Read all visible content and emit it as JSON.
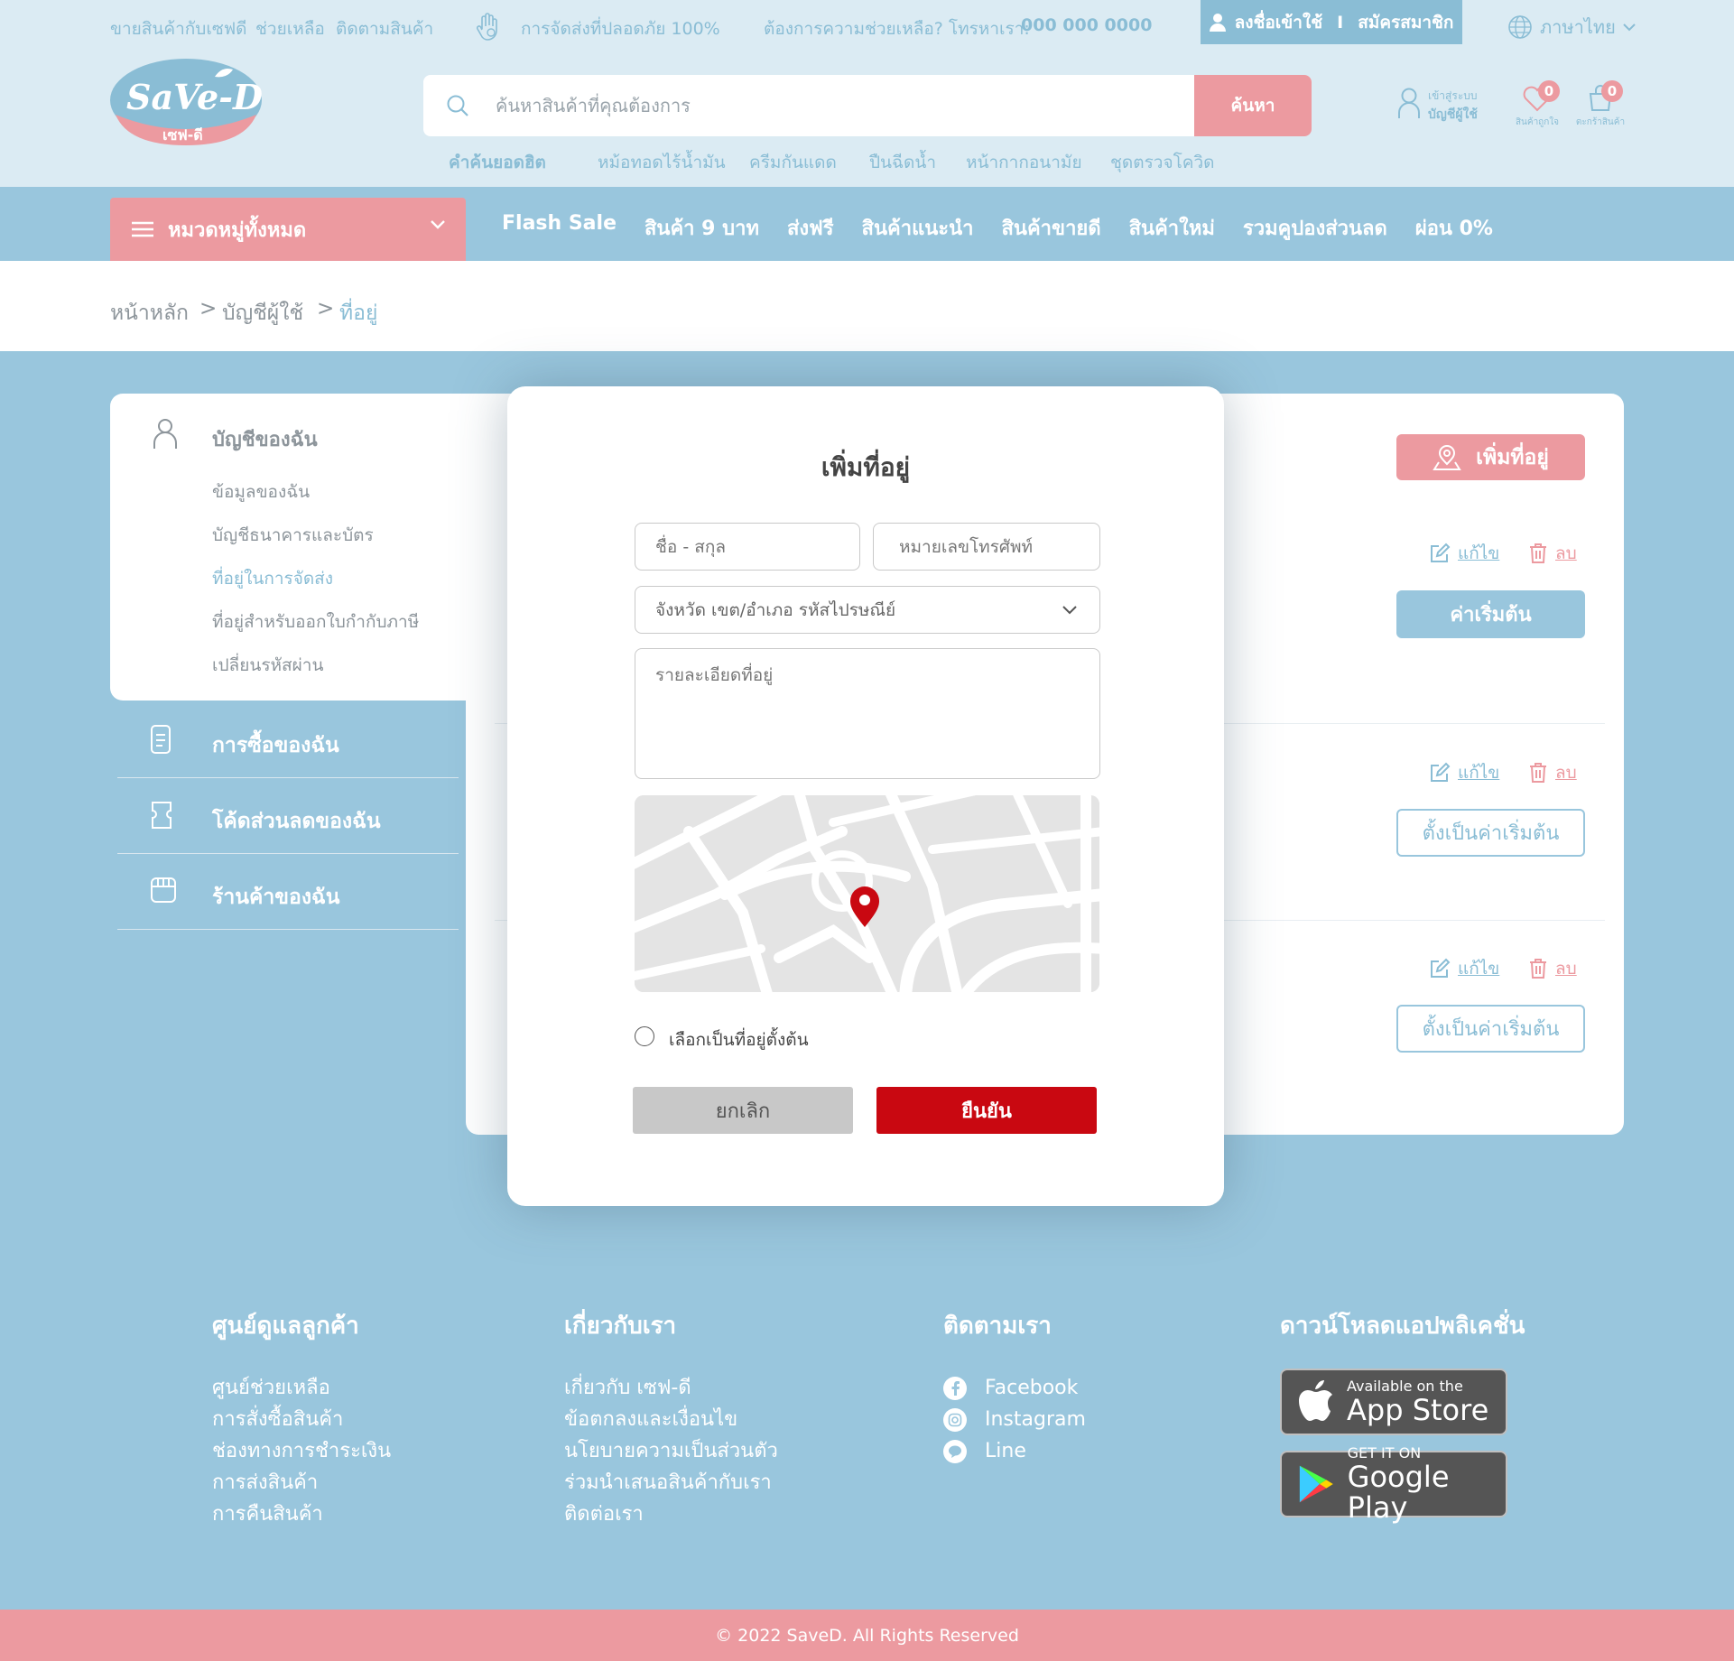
{
  "topbar": {
    "links": [
      "ขายสินค้ากับเซฟดี",
      "ช่วยเหลือ",
      "ติดตามสินค้า"
    ],
    "safe_delivery": "การจัดส่งที่ปลอดภัย 100%",
    "help_prefix": "ต้องการความช่วยเหลือ? โทรหาเรา:",
    "phone": "000 000 0000",
    "login": "ลงชื่อเข้าใช้",
    "separator": "I",
    "register": "สมัครสมาชิก",
    "language": "ภาษาไทย"
  },
  "logo": {
    "brand": "SaVe-D",
    "thai": "เซฟ-ดี"
  },
  "search": {
    "placeholder": "ค้นหาสินค้าที่คุณต้องการ",
    "button": "ค้นหา",
    "hot_label": "คำค้นยอดฮิต",
    "hot_terms": [
      "หม้อทอดไร้น้ำมัน",
      "ครีมกันแดด",
      "ปืนฉีดน้ำ",
      "หน้ากากอนามัย",
      "ชุดตรวจโควิด"
    ]
  },
  "header_icons": {
    "account_line1": "เข้าสู่ระบบ",
    "account_line2": "บัญชีผู้ใช้",
    "wishlist_label": "สินค้าถูกใจ",
    "wishlist_count": "0",
    "cart_label": "ตะกร้าสินค้า",
    "cart_count": "0"
  },
  "nav": {
    "categories": "หมวดหมู่ทั้งหมด",
    "links": [
      "Flash Sale",
      "สินค้า 9 บาท",
      "ส่งฟรี",
      "สินค้าแนะนำ",
      "สินค้าขายดี",
      "สินค้าใหม่",
      "รวมคูปองส่วนลด",
      "ผ่อน 0%"
    ]
  },
  "breadcrumb": {
    "home": "หน้าหลัก",
    "sep": ">",
    "account": "บัญชีผู้ใช้",
    "current": "ที่อยู่"
  },
  "sidebar": {
    "account_title": "บัญชีของฉัน",
    "items": [
      "ข้อมูลของฉัน",
      "บัญชีธนาคารและบัตร",
      "ที่อยู่ในการจัดส่ง",
      "ที่อยู่สำหรับออกใบกำกับภาษี",
      "เปลี่ยนรหัสผ่าน"
    ],
    "groups": [
      "การซื้อของฉัน",
      "โค้ดส่วนลดของฉัน",
      "ร้านค้าของฉัน"
    ]
  },
  "addresses": {
    "add_button": "เพิ่มที่อยู่",
    "edit": "แก้ไข",
    "delete": "ลบ",
    "default_label": "ค่าเริ่มต้น",
    "set_default": "ตั้งเป็นค่าเริ่มต้น"
  },
  "modal": {
    "title": "เพิ่มที่อยู่",
    "name_placeholder": "ชื่อ - สกุล",
    "phone_placeholder": "หมายเลขโทรศัพท์",
    "region_placeholder": "จังหวัด เขต/อำเภอ รหัสไปรษณีย์",
    "detail_placeholder": "รายละเอียดที่อยู่",
    "default_checkbox": "เลือกเป็นที่อยู่ตั้งต้น",
    "cancel": "ยกเลิก",
    "confirm": "ยืนยัน"
  },
  "footer": {
    "col1_title": "ศูนย์ดูแลลูกค้า",
    "col1_items": [
      "ศูนย์ช่วยเหลือ",
      "การสั่งซื้อสินค้า",
      "ช่องทางการชำระเงิน",
      "การส่งสินค้า",
      "การคืนสินค้า"
    ],
    "col2_title": "เกี่ยวกับเรา",
    "col2_items": [
      "เกี่ยวกับ เซฟ-ดี",
      "ข้อตกลงและเงื่อนไข",
      "นโยบายความเป็นส่วนตัว",
      "ร่วมนำเสนอสินค้ากับเรา",
      "ติดต่อเรา"
    ],
    "col3_title": "ติดตามเรา",
    "social": [
      "Facebook",
      "Instagram",
      "Line"
    ],
    "col4_title": "ดาวน์โหลดแอปพลิเคชั่น",
    "appstore_small": "Available on the",
    "appstore_big": "App Store",
    "googleplay_small": "GET IT ON",
    "googleplay_big": "Google Play",
    "copyright": "© 2022 SaveD. All Rights Reserved"
  },
  "colors": {
    "primary_blue": "#99c6dd",
    "pink": "#ec9aa0",
    "confirm_red": "#c90811",
    "header_bg": "#dbebf3"
  }
}
